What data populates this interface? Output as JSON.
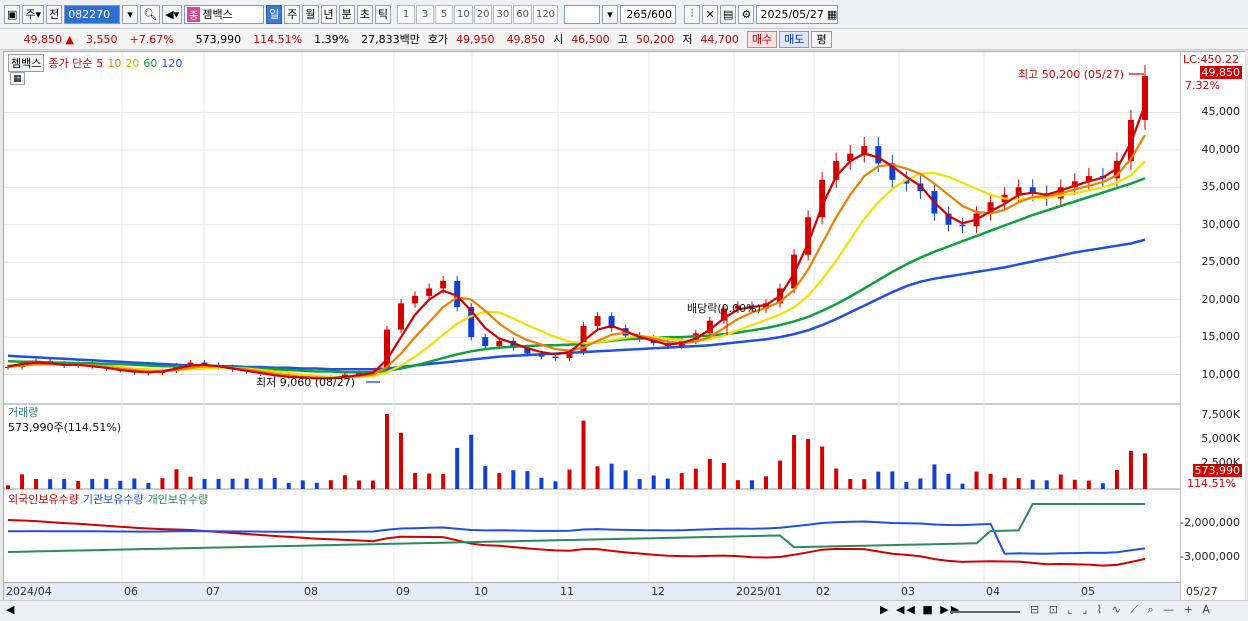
{
  "toolbar": {
    "market": "주",
    "prev": "전",
    "code": "082270",
    "name_badge": "종",
    "name": "젬백스",
    "period_day": "일",
    "period_week": "주",
    "period_month": "월",
    "period_year": "년",
    "period_min": "분",
    "period_sec": "초",
    "period_tick": "틱",
    "intervals": [
      "1",
      "3",
      "5",
      "10",
      "20",
      "30",
      "60",
      "120"
    ],
    "count": "265",
    "count_total": "/600",
    "date": "2025/05/27"
  },
  "quote": {
    "price": "49,850",
    "change": "3,550",
    "rate": "+7.67%",
    "volume": "573,990",
    "vol_ratio": "114.51%",
    "turnover": "1.39%",
    "amount": "27,833백만",
    "ask_label": "호가",
    "ask": "49,950",
    "bid": "49,850",
    "open_label": "시",
    "open": "46,500",
    "high_label": "고",
    "high": "50,200",
    "low_label": "저",
    "low": "44,700",
    "buy_btn": "매수",
    "sell_btn": "매도",
    "eval_btn": "평"
  },
  "legend": {
    "name": "젬백스",
    "price_label": "종가 단순",
    "ma5": "5",
    "ma10": "10",
    "ma20": "20",
    "ma60": "60",
    "ma120": "120"
  },
  "annotations": {
    "high": "최고 50,200 (05/27)",
    "low": "최저 9,060 (08/27)",
    "dividend": "배당락(0.00%)",
    "lc": "LC:450.22",
    "price_tag": "49,850",
    "price_pct": "7.32%"
  },
  "volume_panel": {
    "title": "거래량",
    "value": "573,990주(114.51%)",
    "tag": "573,990",
    "pct": "114.51%"
  },
  "holders_panel": {
    "foreign": "외국인보유수량",
    "inst": "기관보유수량",
    "retail": "개인보유수량"
  },
  "colors": {
    "ma5": "#d40000",
    "ma10": "#f08000",
    "ma20": "#f0e000",
    "ma60": "#10a040",
    "ma120": "#2050e0",
    "up": "#d40000",
    "down": "#1040d0"
  },
  "chart_data": {
    "type": "line",
    "x_labels": [
      "2024/04",
      "06",
      "07",
      "08",
      "09",
      "10",
      "11",
      "12",
      "2025/01",
      "02",
      "03",
      "04",
      "05",
      "05/27"
    ],
    "y_ticks": [
      "45,000",
      "40,000",
      "35,000",
      "30,000",
      "25,000",
      "20,000",
      "15,000",
      "10,000"
    ],
    "ylim": [
      7000,
      52000
    ],
    "volume_ticks": [
      "7,500K",
      "5,000K",
      "2,500K"
    ],
    "holder_ticks": [
      "-2,000,000",
      "-3,000,000"
    ],
    "close": [
      11000,
      11500,
      11800,
      11500,
      11200,
      11400,
      11100,
      10800,
      10600,
      10300,
      10200,
      10500,
      11200,
      11600,
      11300,
      11000,
      10700,
      10400,
      10100,
      9800,
      9700,
      9500,
      9400,
      9600,
      10000,
      10200,
      10400,
      16000,
      19500,
      20500,
      21500,
      22500,
      19000,
      15000,
      13800,
      14500,
      13600,
      12800,
      12400,
      12200,
      13000,
      16500,
      17800,
      16200,
      15200,
      14800,
      14200,
      13800,
      14500,
      15500,
      17200,
      18800,
      19200,
      18800,
      19500,
      21500,
      26000,
      31000,
      36000,
      38500,
      39500,
      40500,
      38200,
      36000,
      35500,
      34500,
      31500,
      30000,
      29800,
      31500,
      33000,
      34000,
      35000,
      34200,
      33500,
      35000,
      35800,
      36500,
      36200,
      38500,
      44000,
      49850
    ],
    "ma5": [
      11100,
      11400,
      11600,
      11500,
      11300,
      11300,
      11100,
      10900,
      10600,
      10400,
      10300,
      10400,
      10800,
      11200,
      11300,
      11100,
      10800,
      10500,
      10200,
      9900,
      9700,
      9600,
      9500,
      9500,
      9700,
      9900,
      10200,
      12000,
      15000,
      18000,
      20000,
      21200,
      20500,
      18500,
      16200,
      14800,
      14200,
      13500,
      13000,
      12700,
      13000,
      14500,
      16000,
      16500,
      15800,
      15000,
      14500,
      14000,
      14200,
      14800,
      16000,
      17500,
      18700,
      19000,
      19300,
      20500,
      23500,
      27500,
      32500,
      36500,
      38500,
      39500,
      39000,
      37800,
      36400,
      35200,
      33000,
      31200,
      30200,
      30700,
      31800,
      32800,
      34000,
      34300,
      34000,
      34600,
      35200,
      35800,
      36300,
      37500,
      41000,
      46000
    ],
    "ma10": [
      11000,
      11200,
      11400,
      11400,
      11300,
      11300,
      11200,
      11000,
      10800,
      10600,
      10400,
      10400,
      10600,
      10900,
      11100,
      11100,
      10900,
      10700,
      10400,
      10100,
      9900,
      9700,
      9600,
      9500,
      9600,
      9800,
      10000,
      11000,
      12800,
      15000,
      17000,
      19000,
      20300,
      20000,
      18500,
      16800,
      15500,
      14600,
      14000,
      13400,
      13200,
      13600,
      14500,
      15300,
      15600,
      15200,
      14800,
      14400,
      14200,
      14400,
      15000,
      16200,
      17400,
      18300,
      18900,
      19700,
      21300,
      24000,
      27500,
      31000,
      34000,
      36500,
      37800,
      38000,
      37500,
      36800,
      35500,
      34000,
      32500,
      31700,
      31500,
      32000,
      33000,
      33700,
      33800,
      34200,
      34700,
      35200,
      35700,
      36600,
      38800,
      42000
    ],
    "ma20": [
      11200,
      11200,
      11300,
      11300,
      11300,
      11300,
      11200,
      11100,
      11000,
      10800,
      10700,
      10600,
      10600,
      10700,
      10800,
      10900,
      10900,
      10800,
      10600,
      10400,
      10200,
      10000,
      9800,
      9700,
      9700,
      9700,
      9800,
      10300,
      11200,
      12400,
      13800,
      15300,
      16800,
      17800,
      18400,
      18300,
      17500,
      16600,
      15800,
      15000,
      14400,
      14200,
      14300,
      14600,
      14900,
      15100,
      15000,
      14800,
      14600,
      14500,
      14700,
      15200,
      15900,
      16600,
      17300,
      18000,
      19000,
      20500,
      22700,
      25200,
      28000,
      30800,
      33000,
      34800,
      36000,
      36800,
      36900,
      36400,
      35600,
      34800,
      34000,
      33500,
      33400,
      33500,
      33600,
      33900,
      34200,
      34600,
      35000,
      35600,
      36600,
      38500
    ],
    "ma60": [
      11800,
      11700,
      11700,
      11600,
      11600,
      11500,
      11500,
      11400,
      11400,
      11300,
      11200,
      11100,
      11100,
      11000,
      11000,
      11000,
      10900,
      10900,
      10800,
      10700,
      10600,
      10500,
      10400,
      10400,
      10300,
      10300,
      10300,
      10500,
      10800,
      11200,
      11700,
      12200,
      12700,
      13100,
      13400,
      13600,
      13700,
      13800,
      13900,
      13900,
      14000,
      14100,
      14300,
      14500,
      14700,
      14800,
      14900,
      15000,
      15000,
      15100,
      15200,
      15400,
      15600,
      15900,
      16200,
      16600,
      17100,
      17700,
      18500,
      19400,
      20400,
      21500,
      22600,
      23700,
      24700,
      25600,
      26400,
      27100,
      27800,
      28500,
      29200,
      29900,
      30600,
      31300,
      31900,
      32500,
      33100,
      33700,
      34300,
      34900,
      35500,
      36200
    ],
    "ma120": [
      12500,
      12400,
      12300,
      12200,
      12100,
      12000,
      11900,
      11800,
      11700,
      11600,
      11500,
      11400,
      11300,
      11200,
      11200,
      11100,
      11100,
      11000,
      11000,
      10900,
      10900,
      10800,
      10800,
      10700,
      10700,
      10700,
      10700,
      10800,
      11000,
      11200,
      11400,
      11600,
      11800,
      12000,
      12200,
      12400,
      12500,
      12600,
      12700,
      12800,
      12900,
      13000,
      13100,
      13200,
      13300,
      13400,
      13500,
      13600,
      13700,
      13800,
      13900,
      14100,
      14300,
      14500,
      14700,
      15000,
      15400,
      15900,
      16600,
      17400,
      18300,
      19200,
      20100,
      21000,
      21800,
      22400,
      22800,
      23100,
      23400,
      23700,
      24000,
      24300,
      24700,
      25100,
      25500,
      25900,
      26300,
      26600,
      26900,
      27200,
      27500,
      28000
    ]
  }
}
